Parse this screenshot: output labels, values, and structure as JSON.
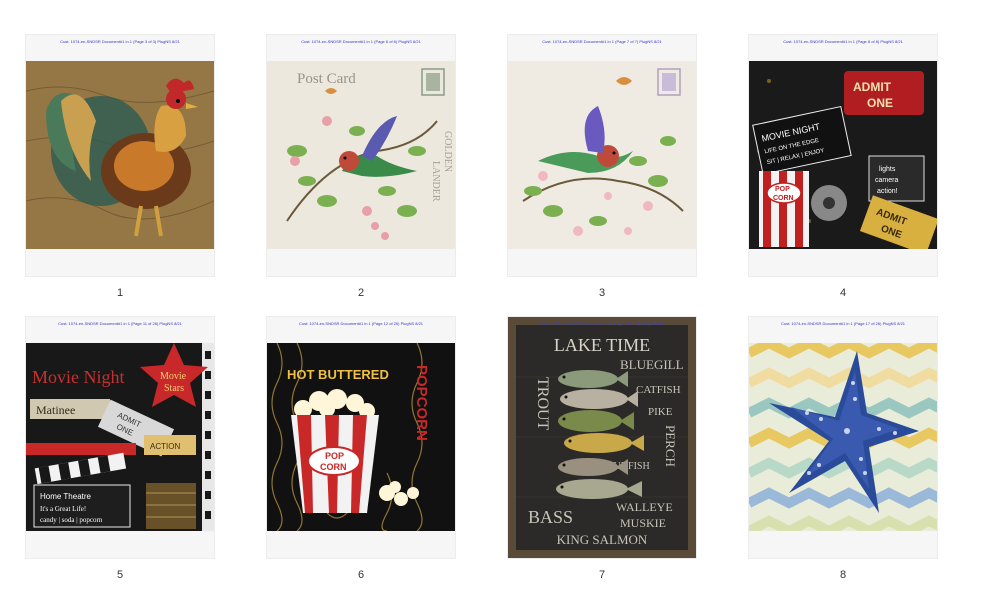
{
  "header": {
    "title": ""
  },
  "pages": [
    {
      "number": "1",
      "header_text": "Cust: 1074-en-SNDSR Document#1 in 1 (Page 3 of 3) PlugNS 8/21",
      "art": "rooster-artwork",
      "accent": "#7a5a2a"
    },
    {
      "number": "2",
      "header_text": "Cust: 1074-en-SNDSR Document#1 in 1 (Page 6 of 6) PlugNS 8/21",
      "art": "bird-postcard-artwork",
      "accent": "#e9e4d9",
      "texts": [
        "Post Card",
        "GOLDEN",
        "LANDER"
      ]
    },
    {
      "number": "3",
      "header_text": "Cust: 1074-en-SNDSR Document#1 in 1 (Page 7 of 7) PlugNS 8/21",
      "art": "bird-floral-artwork",
      "accent": "#ece8e0"
    },
    {
      "number": "4",
      "header_text": "Cust: 1074-en-SNDSR Document#1 in 1 (Page 8 of 8) PlugNS 8/21",
      "art": "movie-night-artwork",
      "accent": "#b01e22",
      "texts": [
        "ADMIT",
        "ONE",
        "MOVIE NIGHT",
        "LIFE ON THE EDGE",
        "SIT | RELAX | ENJOY",
        "POP",
        "CORN",
        "lights",
        "camera",
        "action!",
        "ADMIT",
        "ONE"
      ]
    },
    {
      "number": "5",
      "header_text": "Cust: 1074-en-SNDSR Document#1 in 1 (Page 11 of 26) PlugNS 8/21",
      "art": "movie-stars-artwork",
      "accent": "#c0262a",
      "texts": [
        "Movie Night",
        "Movie",
        "Stars",
        "Matinee",
        "ADMIT",
        "ONE",
        "ACTION",
        "Home Theatre",
        "It's a Great Life!",
        "candy | soda | popcorn"
      ]
    },
    {
      "number": "6",
      "header_text": "Cust: 1074-en-SNDSR Document#1 in 1 (Page 12 of 26) PlugNS 8/21",
      "art": "popcorn-artwork",
      "accent": "#111111",
      "texts": [
        "HOT BUTTERED",
        "POPCORN",
        "POP",
        "CORN"
      ]
    },
    {
      "number": "7",
      "header_text": "Cust: 1074-en-SNDSR Document#1 in 1 (Page 14 of 26) PlugNS 8/21",
      "art": "lake-time-fish-artwork",
      "accent": "#4a3a2a",
      "texts": [
        "LAKE TIME",
        "BLUEGILL",
        "CATFISH",
        "PIKE",
        "TROUT",
        "PERCH",
        "SUNFISH",
        "WALLEYE",
        "MUSKIE",
        "BASS",
        "KING SALMON"
      ]
    },
    {
      "number": "8",
      "header_text": "Cust: 1074-en-SNDSR Document#1 in 1 (Page 17 of 26) PlugNS 8/21",
      "art": "starfish-artwork",
      "accent": "#2a4a9a"
    }
  ]
}
